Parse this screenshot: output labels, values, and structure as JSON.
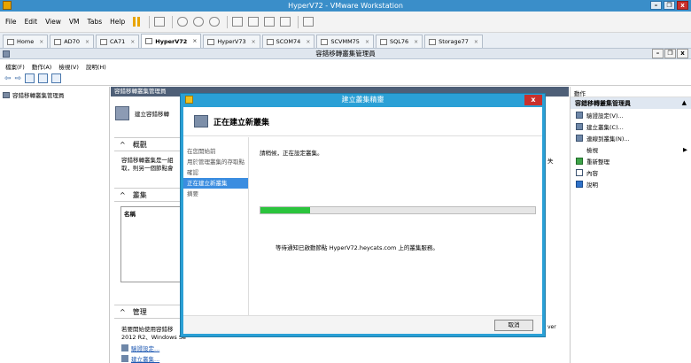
{
  "vm": {
    "title": "HyperV72 - VMware Workstation",
    "menu": [
      "File",
      "Edit",
      "View",
      "VM",
      "Tabs",
      "Help"
    ],
    "tabs": [
      {
        "label": "Home",
        "active": false
      },
      {
        "label": "AD70",
        "active": false
      },
      {
        "label": "CA71",
        "active": false
      },
      {
        "label": "HyperV72",
        "active": true
      },
      {
        "label": "HyperV73",
        "active": false
      },
      {
        "label": "SCOM74",
        "active": false
      },
      {
        "label": "SCVMM75",
        "active": false
      },
      {
        "label": "SQL76",
        "active": false
      },
      {
        "label": "Storage77",
        "active": false
      }
    ]
  },
  "guest": {
    "title": "容錯移轉叢集管理員",
    "menu": [
      "檔案(F)",
      "動作(A)",
      "檢視(V)",
      "說明(H)"
    ]
  },
  "tree": {
    "root": "容錯移轉叢集管理員"
  },
  "center": {
    "header": "容錯移轉叢集管理員",
    "create_link": "建立容錯移轉",
    "overview_title": "概觀",
    "overview_text1": "容錯移轉叢集是一組",
    "overview_text2": "取，則另一個節點會",
    "clusters_title": "叢集",
    "grid_header": "名稱",
    "manage_title": "管理",
    "manage_text1": "若要開始使用容錯移",
    "manage_text2": "2012 R2、Windows Se",
    "link_validate": "驗證設定...",
    "link_create": "建立叢集...",
    "right_frag1": "失",
    "right_frag2": "ver"
  },
  "actions": {
    "header": "動作",
    "subheader": "容錯移轉叢集管理員",
    "items": [
      "驗證設定(V)...",
      "建立叢集(C)...",
      "連線到叢集(N)...",
      "檢視",
      "重新整理",
      "內容",
      "說明"
    ]
  },
  "dialog": {
    "title": "建立叢集精靈",
    "heading": "正在建立新叢集",
    "steps": [
      "在您開始前",
      "用於管理叢集的存取點",
      "確認",
      "正在建立新叢集",
      "摘要"
    ],
    "current_step": 3,
    "status": "請稍候，正在設定叢集。",
    "progress_fraction": 0.18,
    "wait_message": "等待通知已啟動節點 HyperV72.heycats.com 上的叢集服務。",
    "cancel_label": "取消",
    "close_symbol": "x"
  }
}
